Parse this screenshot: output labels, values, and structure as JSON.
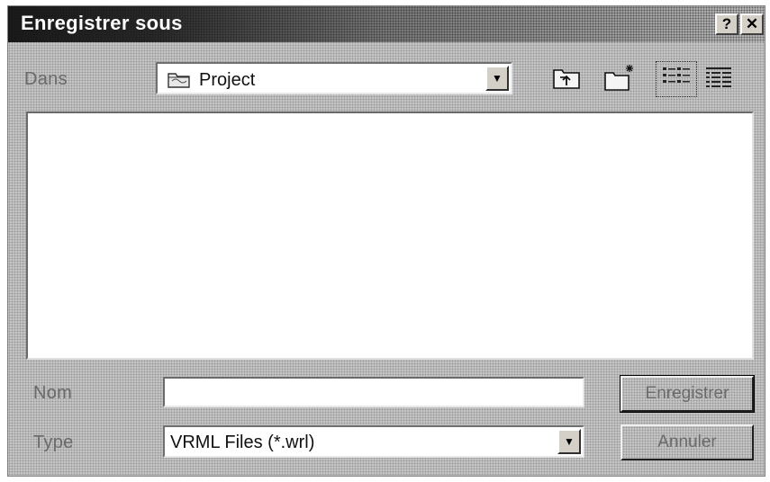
{
  "window": {
    "title": "Enregistrer sous",
    "help_glyph": "?",
    "close_glyph": "✕"
  },
  "location": {
    "label": "Dans",
    "value": "Project",
    "icon": "folder-icon"
  },
  "toolbar": {
    "buttons": [
      "up-one-level-icon",
      "new-folder-icon",
      "list-view-icon",
      "details-view-icon"
    ]
  },
  "filename": {
    "label": "Nom",
    "value": ""
  },
  "filetype": {
    "label": "Type",
    "value": "VRML Files (*.wrl)"
  },
  "buttons": {
    "save_label": "Enregistrer",
    "cancel_label": "Annuler"
  }
}
